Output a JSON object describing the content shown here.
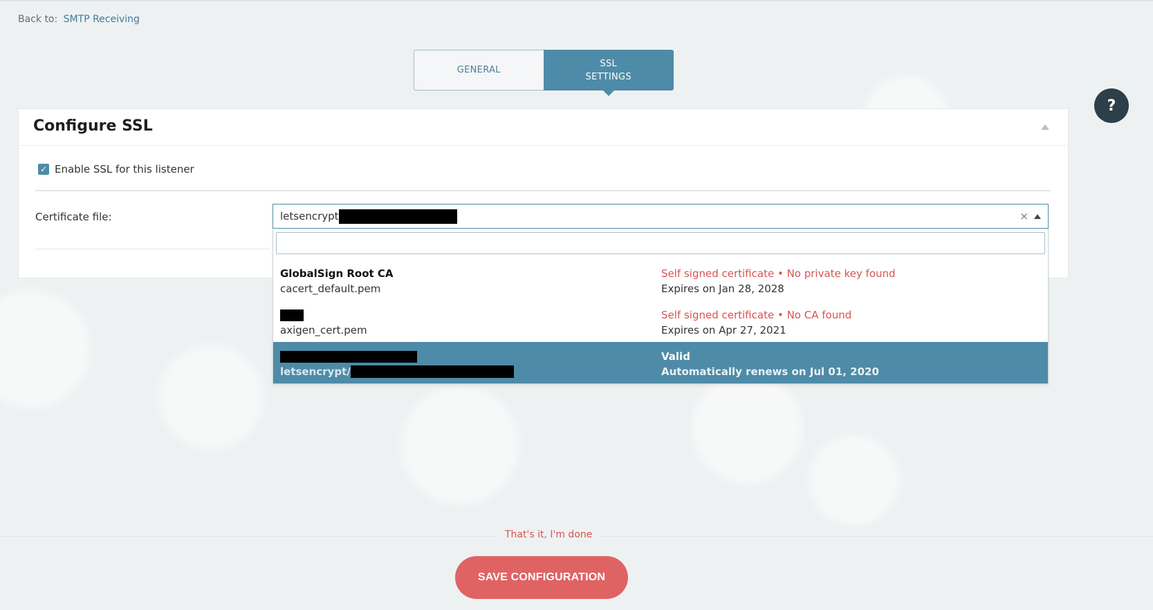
{
  "breadcrumb": {
    "prefix": "Back to:",
    "link": "SMTP Receiving"
  },
  "tabs": [
    {
      "label": "GENERAL",
      "active": false
    },
    {
      "label_line1": "SSL",
      "label_line2": "SETTINGS",
      "active": true
    }
  ],
  "help": {
    "label": "?"
  },
  "panel": {
    "title": "Configure SSL",
    "enable_ssl": {
      "label": "Enable SSL for this listener",
      "checked": true
    },
    "certificate_label": "Certificate file:"
  },
  "select": {
    "value_prefix": "letsencrypt",
    "clear_icon": "×",
    "search_placeholder": ""
  },
  "options": [
    {
      "name": "GlobalSign Root CA",
      "file": "cacert_default.pem",
      "status": "Self signed certificate • No private key found",
      "expiry": "Expires on Jan 28, 2028",
      "selected": false
    },
    {
      "name": "",
      "file": "axigen_cert.pem",
      "status": "Self signed certificate • No CA found",
      "expiry": "Expires on Apr 27, 2021",
      "selected": false
    },
    {
      "name": "",
      "file_prefix": "letsencrypt/",
      "status": "Valid",
      "expiry": "Automatically renews on Jul 01, 2020",
      "selected": true
    }
  ],
  "footer": {
    "done_text": "That's it, I'm done",
    "save_label": "SAVE CONFIGURATION"
  },
  "colors": {
    "accent": "#4e8ba8",
    "danger": "#d9534f",
    "save_button": "#e06363",
    "help_bg": "#2d3f48"
  }
}
